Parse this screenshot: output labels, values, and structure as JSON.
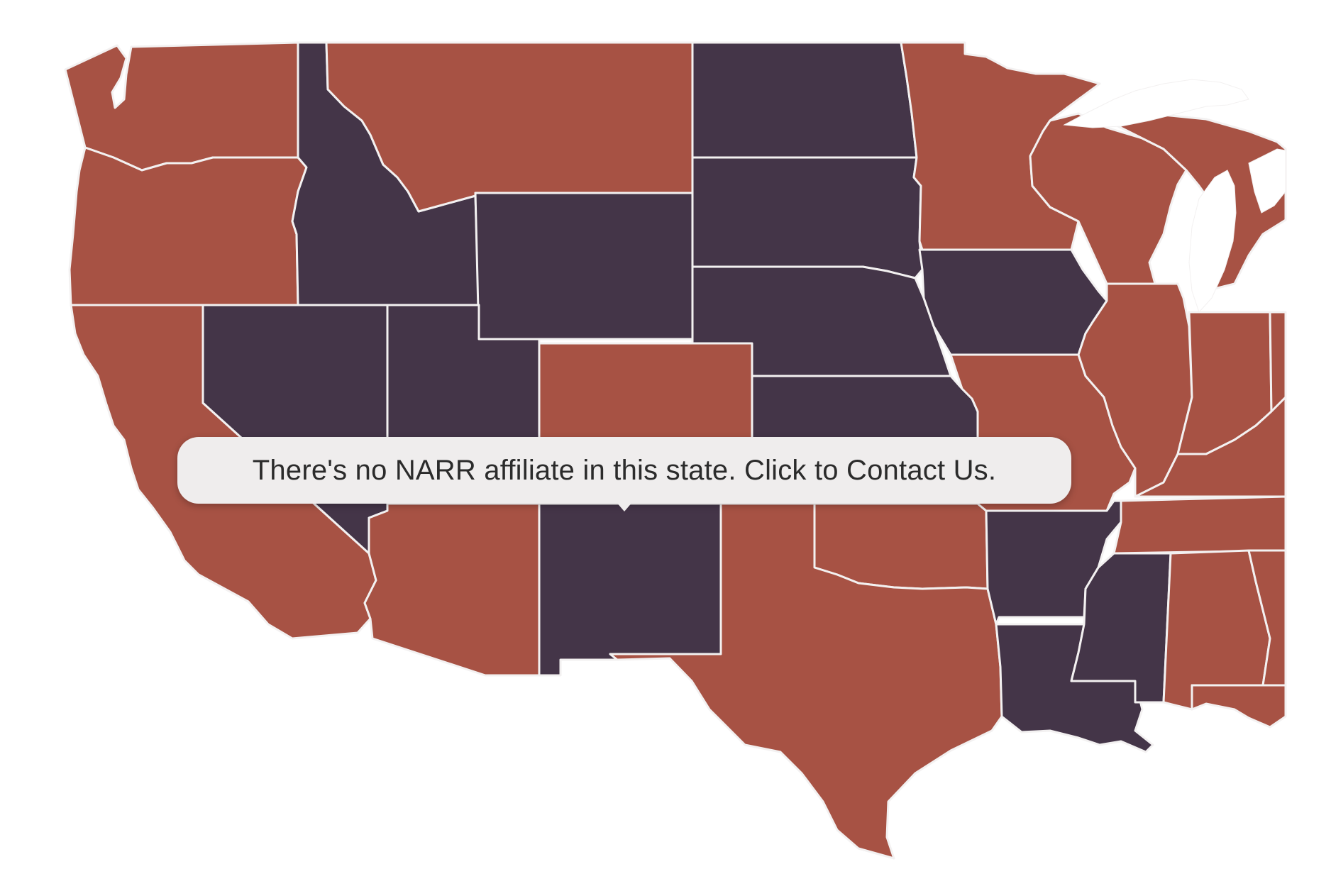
{
  "map": {
    "colors": {
      "has_affiliate": "#a75244",
      "no_affiliate": "#443548",
      "border": "#f3f1f1",
      "background": "#ffffff"
    },
    "states": [
      {
        "code": "WA",
        "affiliate": true
      },
      {
        "code": "OR",
        "affiliate": true
      },
      {
        "code": "CA",
        "affiliate": true
      },
      {
        "code": "ID",
        "affiliate": false
      },
      {
        "code": "NV",
        "affiliate": false
      },
      {
        "code": "MT",
        "affiliate": true
      },
      {
        "code": "WY",
        "affiliate": false
      },
      {
        "code": "UT",
        "affiliate": false
      },
      {
        "code": "AZ",
        "affiliate": true
      },
      {
        "code": "CO",
        "affiliate": true
      },
      {
        "code": "NM",
        "affiliate": false
      },
      {
        "code": "ND",
        "affiliate": false
      },
      {
        "code": "SD",
        "affiliate": false
      },
      {
        "code": "NE",
        "affiliate": false
      },
      {
        "code": "KS",
        "affiliate": false
      },
      {
        "code": "OK",
        "affiliate": true
      },
      {
        "code": "TX",
        "affiliate": true
      },
      {
        "code": "MN",
        "affiliate": true
      },
      {
        "code": "IA",
        "affiliate": false
      },
      {
        "code": "MO",
        "affiliate": true
      },
      {
        "code": "AR",
        "affiliate": false
      },
      {
        "code": "LA",
        "affiliate": false
      },
      {
        "code": "WI",
        "affiliate": true
      },
      {
        "code": "IL",
        "affiliate": true
      },
      {
        "code": "MS",
        "affiliate": false
      },
      {
        "code": "MI",
        "affiliate": true
      },
      {
        "code": "IN",
        "affiliate": true
      },
      {
        "code": "OH",
        "affiliate": true
      },
      {
        "code": "KY",
        "affiliate": true
      },
      {
        "code": "TN",
        "affiliate": true
      },
      {
        "code": "AL",
        "affiliate": true
      },
      {
        "code": "GA",
        "affiliate": true
      },
      {
        "code": "FL",
        "affiliate": true
      }
    ]
  },
  "tooltip": {
    "text": "There's no NARR affiliate in this state. Click to Contact Us."
  }
}
